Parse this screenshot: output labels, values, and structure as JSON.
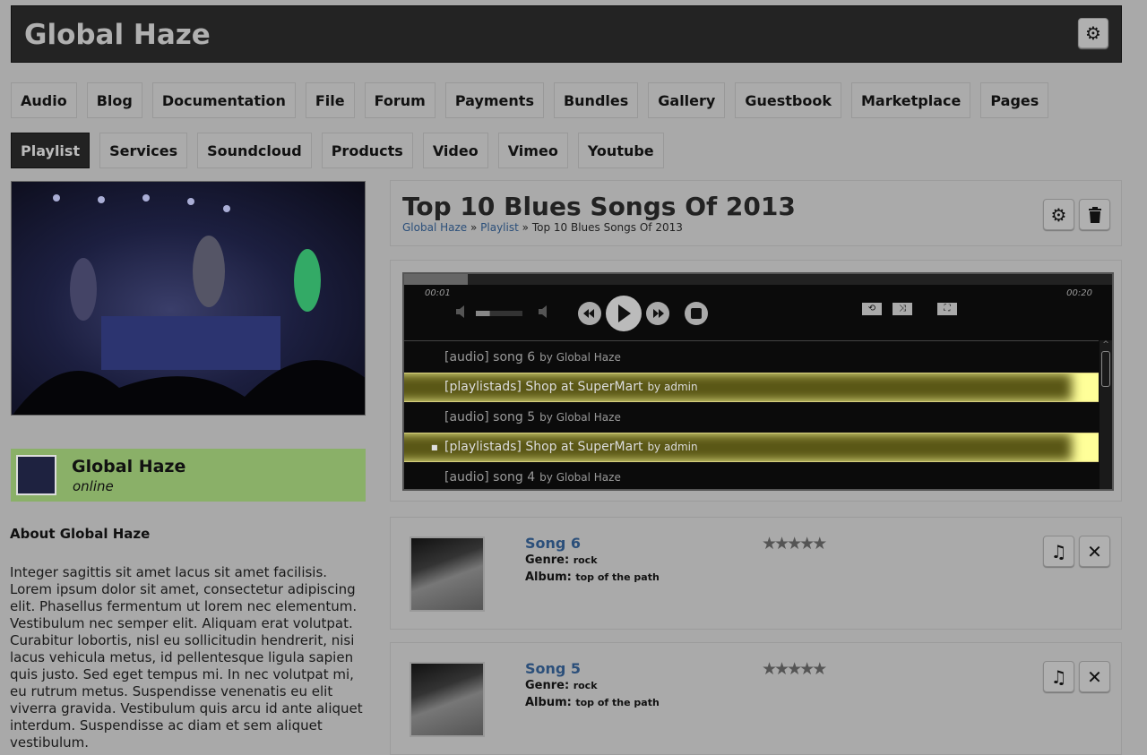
{
  "header": {
    "title": "Global Haze"
  },
  "nav": [
    "Audio",
    "Blog",
    "Documentation",
    "File",
    "Forum",
    "Payments",
    "Bundles",
    "Gallery",
    "Guestbook",
    "Marketplace",
    "Pages",
    "Playlist",
    "Services",
    "Soundcloud",
    "Products",
    "Video",
    "Vimeo",
    "Youtube"
  ],
  "nav_active": "Playlist",
  "profile": {
    "name": "Global Haze",
    "status": "online"
  },
  "about": {
    "heading": "About Global Haze",
    "text": "Integer sagittis sit amet lacus sit amet facilisis. Lorem ipsum dolor sit amet, consectetur adipiscing elit. Phasellus fermentum ut lorem nec elementum. Vestibulum nec semper elit. Aliquam erat volutpat. Curabitur lobortis, nisl eu sollicitudin hendrerit, nisi lacus vehicula metus, id pellentesque ligula sapien quis justo. Sed eget tempus mi. In nec volutpat mi, eu rutrum metus. Suspendisse venenatis eu elit viverra gravida. Vestibulum quis arcu id ante aliquet interdum. Suspendisse ac diam et sem aliquet vestibulum."
  },
  "playlist": {
    "title": "Top 10 Blues Songs Of 2013",
    "breadcrumb": [
      "Global Haze",
      "Playlist",
      "Top 10 Blues Songs Of 2013"
    ],
    "breadcrumb_sep": "»"
  },
  "player": {
    "current_time": "00:01",
    "duration": "00:20",
    "progress_fraction": 0.09,
    "volume_fraction": 0.3,
    "tracks": [
      {
        "title": "[audio] song 6",
        "by": "by Global Haze",
        "ad": false,
        "current": false
      },
      {
        "title": "[playlistads] Shop at SuperMart",
        "by": "by admin",
        "ad": true,
        "current": false
      },
      {
        "title": "[audio] song 5",
        "by": "by Global Haze",
        "ad": false,
        "current": false
      },
      {
        "title": "[playlistads] Shop at SuperMart",
        "by": "by admin",
        "ad": true,
        "current": true
      },
      {
        "title": "[audio] song 4",
        "by": "by Global Haze",
        "ad": false,
        "current": false
      }
    ]
  },
  "songs": [
    {
      "name": "Song 6",
      "genre_label": "Genre:",
      "genre": "rock",
      "album_label": "Album:",
      "album": "top of the path",
      "rating": 5
    },
    {
      "name": "Song 5",
      "genre_label": "Genre:",
      "genre": "rock",
      "album_label": "Album:",
      "album": "top of the path",
      "rating": 5
    }
  ],
  "colors": {
    "header_bg": "#232323",
    "profile_bg": "#8ab068",
    "link": "#2b4f7a",
    "ad_row": "#5a5716"
  }
}
